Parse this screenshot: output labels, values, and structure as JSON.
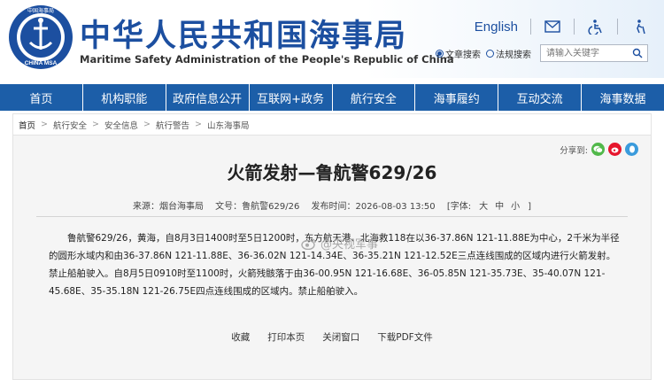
{
  "site": {
    "title_cn": "中华人民共和国海事局",
    "title_en": "Maritime Safety Administration of the People's Republic of China",
    "logo_text": "CHINA MSA",
    "logo_top_text": "中国海事局"
  },
  "top_links": {
    "english": "English",
    "icons": [
      "mail-icon",
      "accessibility-icon",
      "elderly-mode-icon"
    ]
  },
  "search": {
    "options": [
      "文章搜索",
      "法规搜索"
    ],
    "selected": "文章搜索",
    "placeholder": "请输入关键字",
    "icon": "search-icon"
  },
  "nav": {
    "items": [
      "首页",
      "机构职能",
      "政府信息公开",
      "互联网+政务",
      "航行安全",
      "海事履约",
      "互动交流",
      "海事数据"
    ],
    "bg_color": "#1c5ea8"
  },
  "breadcrumb": [
    "首页",
    "航行安全",
    "安全信息",
    "航行警告",
    "山东海事局"
  ],
  "share": {
    "label": "分享到:",
    "icons": [
      "wechat-icon",
      "weibo-icon",
      "qq-icon"
    ]
  },
  "article": {
    "title": "火箭发射—鲁航警629/26",
    "source": "来源：烟台海事局",
    "doc_no": "文号：鲁航警629/26",
    "published": "发布时间：2026-08-03 13:50",
    "font_label": "[字体:",
    "font_sizes": [
      "大",
      "中",
      "小"
    ],
    "font_close": "]",
    "body": "鲁航警629/26，黄海，自8月3日1400时至5日1200时，东方航天港、北海救118在以36-37.86N 121-11.88E为中心，2千米为半径的圆形水域内和由36-37.86N 121-11.88E、36-36.02N 121-14.34E、36-35.21N 121-12.52E三点连线围成的区域内进行火箭发射。禁止船舶驶入。自8月5日0910时至1100时，火箭残骸落于由36-00.95N 121-16.68E、36-05.85N 121-35.73E、35-40.07N 121-45.68E、35-35.18N 121-26.75E四点连线围成的区域内。禁止船舶驶入。"
  },
  "actions": [
    "收藏",
    "打印本页",
    "关闭窗口",
    "下载PDF文件"
  ],
  "watermark": "@央视军事"
}
